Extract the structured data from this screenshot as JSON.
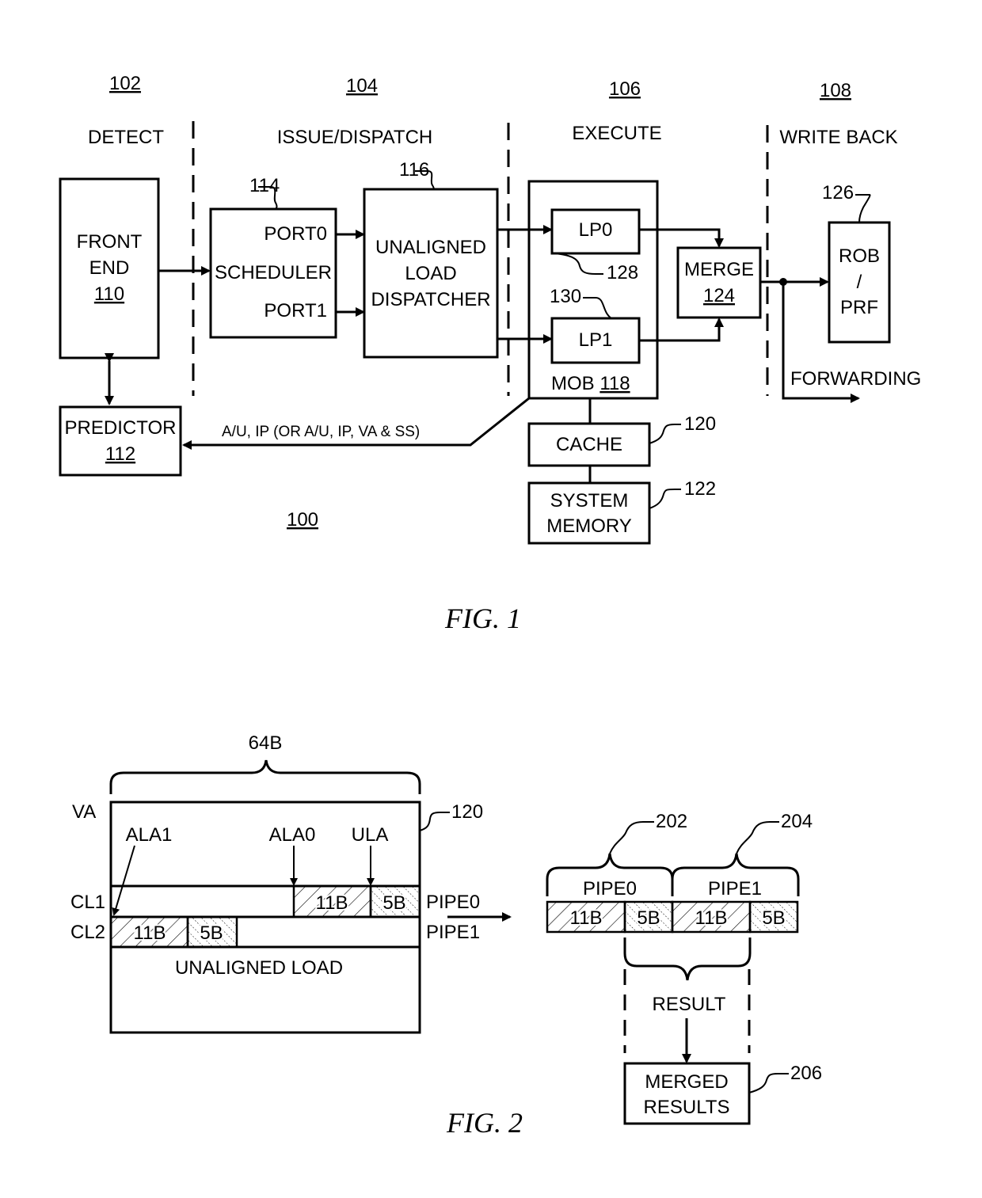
{
  "fig1": {
    "caption": "FIG. 1",
    "system_ref": "100",
    "stages": [
      {
        "ref": "102",
        "label": "DETECT"
      },
      {
        "ref": "104",
        "label": "ISSUE/DISPATCH"
      },
      {
        "ref": "106",
        "label": "EXECUTE"
      },
      {
        "ref": "108",
        "label": "WRITE BACK"
      }
    ],
    "front_end": {
      "line1": "FRONT",
      "line2": "END",
      "ref": "110"
    },
    "predictor": {
      "label": "PREDICTOR",
      "ref": "112"
    },
    "scheduler": {
      "ref": "114",
      "label": "SCHEDULER",
      "port0": "PORT0",
      "port1": "PORT1"
    },
    "dispatcher": {
      "ref": "116",
      "line1": "UNALIGNED",
      "line2": "LOAD",
      "line3": "DISPATCHER"
    },
    "mob": {
      "label": "MOB",
      "ref": "118"
    },
    "lp0": {
      "label": "LP0",
      "ref": "128"
    },
    "lp1": {
      "label": "LP1",
      "ref": "130"
    },
    "merge": {
      "label": "MERGE",
      "ref": "124"
    },
    "rob": {
      "ref": "126",
      "line1": "ROB",
      "line2": "/",
      "line3": "PRF"
    },
    "cache": {
      "label": "CACHE",
      "ref": "120"
    },
    "memory": {
      "line1": "SYSTEM",
      "line2": "MEMORY",
      "ref": "122"
    },
    "forwarding": "FORWARDING",
    "feedback_label": "A/U, IP (OR A/U, IP, VA & SS)"
  },
  "fig2": {
    "caption": "FIG. 2",
    "width_label": "64B",
    "cache_ref": "120",
    "row_labels": {
      "va": "VA",
      "cl1": "CL1",
      "cl2": "CL2"
    },
    "pointers": {
      "ala1": "ALA1",
      "ala0": "ALA0",
      "ula": "ULA"
    },
    "pipe_labels": {
      "pipe0": "PIPE0",
      "pipe1": "PIPE1"
    },
    "segments": {
      "big": "11B",
      "small": "5B"
    },
    "unaligned_load": "UNALIGNED LOAD",
    "pipe0_ref": "202",
    "pipe1_ref": "204",
    "result": "RESULT",
    "merged": {
      "line1": "MERGED",
      "line2": "RESULTS",
      "ref": "206"
    }
  }
}
